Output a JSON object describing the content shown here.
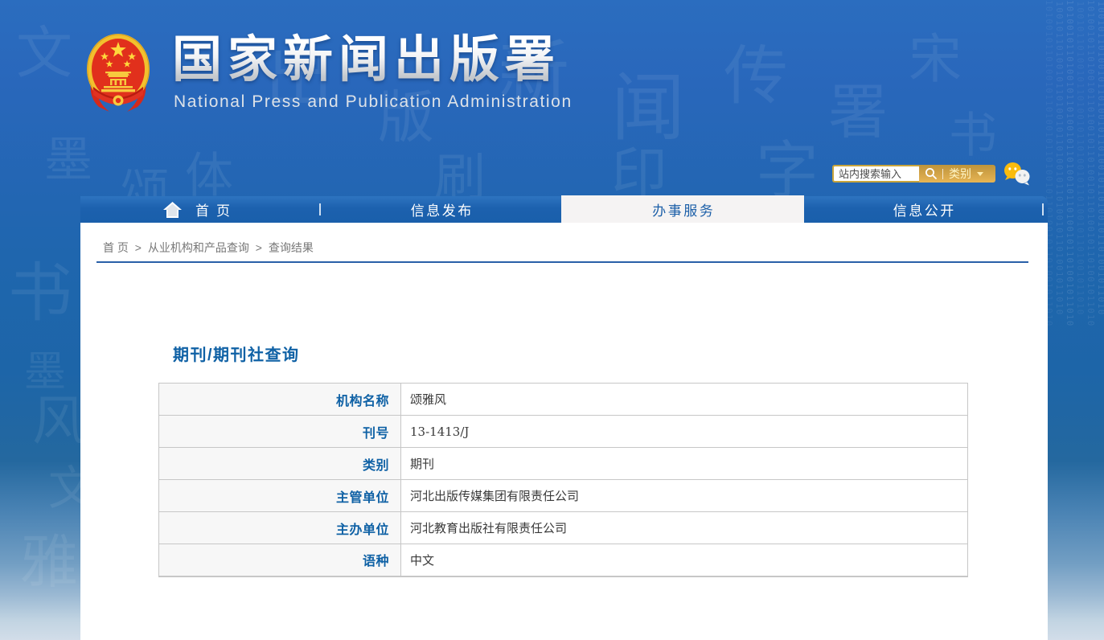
{
  "header": {
    "site_title": "国家新闻出版署",
    "site_subtitle": "National  Press and Publication Administration",
    "emblem": "china-national-emblem"
  },
  "search": {
    "placeholder": "站内搜索输入",
    "search_icon": "magnifier-icon",
    "category_label": "类别",
    "wechat_icon": "wechat-icon"
  },
  "nav": {
    "tabs": [
      {
        "label": "首页",
        "icon": "home-icon",
        "active": false
      },
      {
        "label": "信息发布",
        "active": false
      },
      {
        "label": "办事服务",
        "active": true
      },
      {
        "label": "信息公开",
        "active": false
      }
    ]
  },
  "breadcrumb": {
    "separator": ">",
    "items": [
      "首 页",
      "从业机构和产品查询",
      "查询结果"
    ]
  },
  "main": {
    "title": "期刊/期刊社查询",
    "table": {
      "rows": [
        {
          "label": "机构名称",
          "value": "颂雅风"
        },
        {
          "label": "刊号",
          "value": "13-1413/J"
        },
        {
          "label": "类别",
          "value": "期刊"
        },
        {
          "label": "主管单位",
          "value": "河北出版传媒集团有限责任公司"
        },
        {
          "label": "主办单位",
          "value": "河北教育出版社有限责任公司"
        },
        {
          "label": "语种",
          "value": "中文"
        }
      ]
    }
  },
  "watermarks": {
    "calligraphy_chars": "文墨书风雅颂出版新闻传署印刷字宋体",
    "binary_pattern": "1010010110100101101001011010010110100101"
  },
  "colors": {
    "page_blue": "#2967bb",
    "nav_blue": "#1c61ae",
    "accent_gold": "#d4a549",
    "link_blue": "#0f61a5",
    "divider_blue": "#2960a8",
    "table_border": "#c7c7c7",
    "label_bg": "#f7f7f7"
  }
}
